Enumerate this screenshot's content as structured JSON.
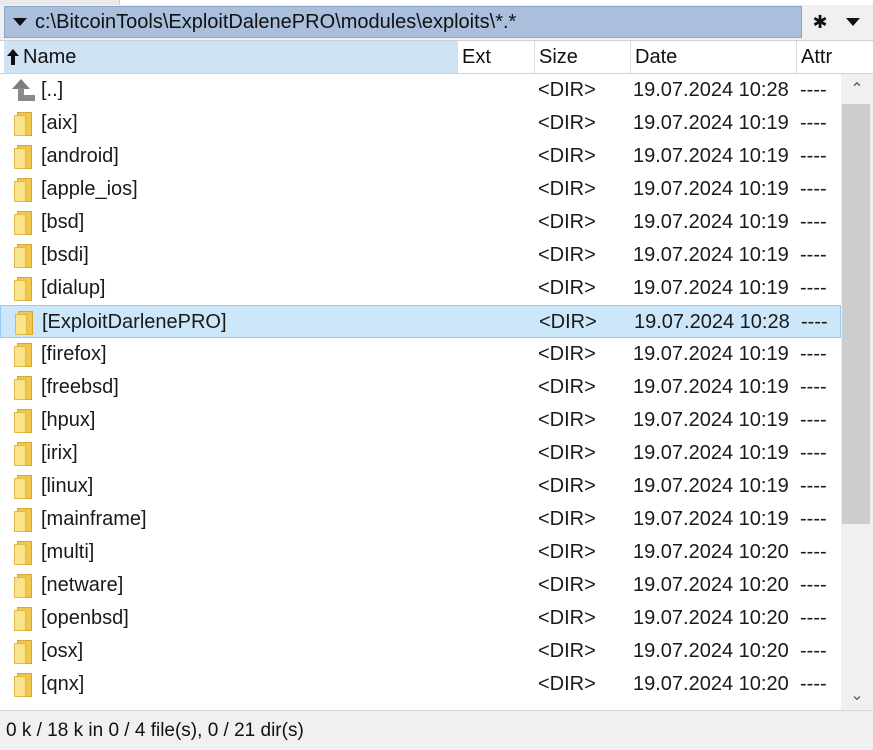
{
  "path_bar": {
    "path": "c:\\BitcoinTools\\ExploitDalenePRO\\modules\\exploits\\*.*",
    "favorites_icon": "asterisk-icon",
    "menu_icon": "chevron-down-icon"
  },
  "columns": {
    "name": "Name",
    "ext": "Ext",
    "size": "Size",
    "date": "Date",
    "attr": "Attr"
  },
  "rows": [
    {
      "name": "[..]",
      "size": "<DIR>",
      "date": "19.07.2024 10:28",
      "attr": "----",
      "icon": "up-folder-icon"
    },
    {
      "name": "[aix]",
      "size": "<DIR>",
      "date": "19.07.2024 10:19",
      "attr": "----",
      "icon": "folder-icon"
    },
    {
      "name": "[android]",
      "size": "<DIR>",
      "date": "19.07.2024 10:19",
      "attr": "----",
      "icon": "folder-icon"
    },
    {
      "name": "[apple_ios]",
      "size": "<DIR>",
      "date": "19.07.2024 10:19",
      "attr": "----",
      "icon": "folder-icon"
    },
    {
      "name": "[bsd]",
      "size": "<DIR>",
      "date": "19.07.2024 10:19",
      "attr": "----",
      "icon": "folder-icon"
    },
    {
      "name": "[bsdi]",
      "size": "<DIR>",
      "date": "19.07.2024 10:19",
      "attr": "----",
      "icon": "folder-icon"
    },
    {
      "name": "[dialup]",
      "size": "<DIR>",
      "date": "19.07.2024 10:19",
      "attr": "----",
      "icon": "folder-icon"
    },
    {
      "name": "[ExploitDarlenePRO]",
      "size": "<DIR>",
      "date": "19.07.2024 10:28",
      "attr": "----",
      "icon": "folder-icon",
      "selected": true
    },
    {
      "name": "[firefox]",
      "size": "<DIR>",
      "date": "19.07.2024 10:19",
      "attr": "----",
      "icon": "folder-icon"
    },
    {
      "name": "[freebsd]",
      "size": "<DIR>",
      "date": "19.07.2024 10:19",
      "attr": "----",
      "icon": "folder-icon"
    },
    {
      "name": "[hpux]",
      "size": "<DIR>",
      "date": "19.07.2024 10:19",
      "attr": "----",
      "icon": "folder-icon"
    },
    {
      "name": "[irix]",
      "size": "<DIR>",
      "date": "19.07.2024 10:19",
      "attr": "----",
      "icon": "folder-icon"
    },
    {
      "name": "[linux]",
      "size": "<DIR>",
      "date": "19.07.2024 10:19",
      "attr": "----",
      "icon": "folder-icon"
    },
    {
      "name": "[mainframe]",
      "size": "<DIR>",
      "date": "19.07.2024 10:19",
      "attr": "----",
      "icon": "folder-icon"
    },
    {
      "name": "[multi]",
      "size": "<DIR>",
      "date": "19.07.2024 10:20",
      "attr": "----",
      "icon": "folder-icon"
    },
    {
      "name": "[netware]",
      "size": "<DIR>",
      "date": "19.07.2024 10:20",
      "attr": "----",
      "icon": "folder-icon"
    },
    {
      "name": "[openbsd]",
      "size": "<DIR>",
      "date": "19.07.2024 10:20",
      "attr": "----",
      "icon": "folder-icon"
    },
    {
      "name": "[osx]",
      "size": "<DIR>",
      "date": "19.07.2024 10:20",
      "attr": "----",
      "icon": "folder-icon"
    },
    {
      "name": "[qnx]",
      "size": "<DIR>",
      "date": "19.07.2024 10:20",
      "attr": "----",
      "icon": "folder-icon"
    }
  ],
  "status": "0 k / 18 k in 0 / 4 file(s), 0 / 21 dir(s)",
  "colors": {
    "path_bar_bg": "#a9bfdc",
    "sorted_header_bg": "#cfe3f5",
    "selection_bg": "#cce6fa",
    "selection_border": "#99c9ef",
    "folder_yellow": "#f1c84b"
  }
}
